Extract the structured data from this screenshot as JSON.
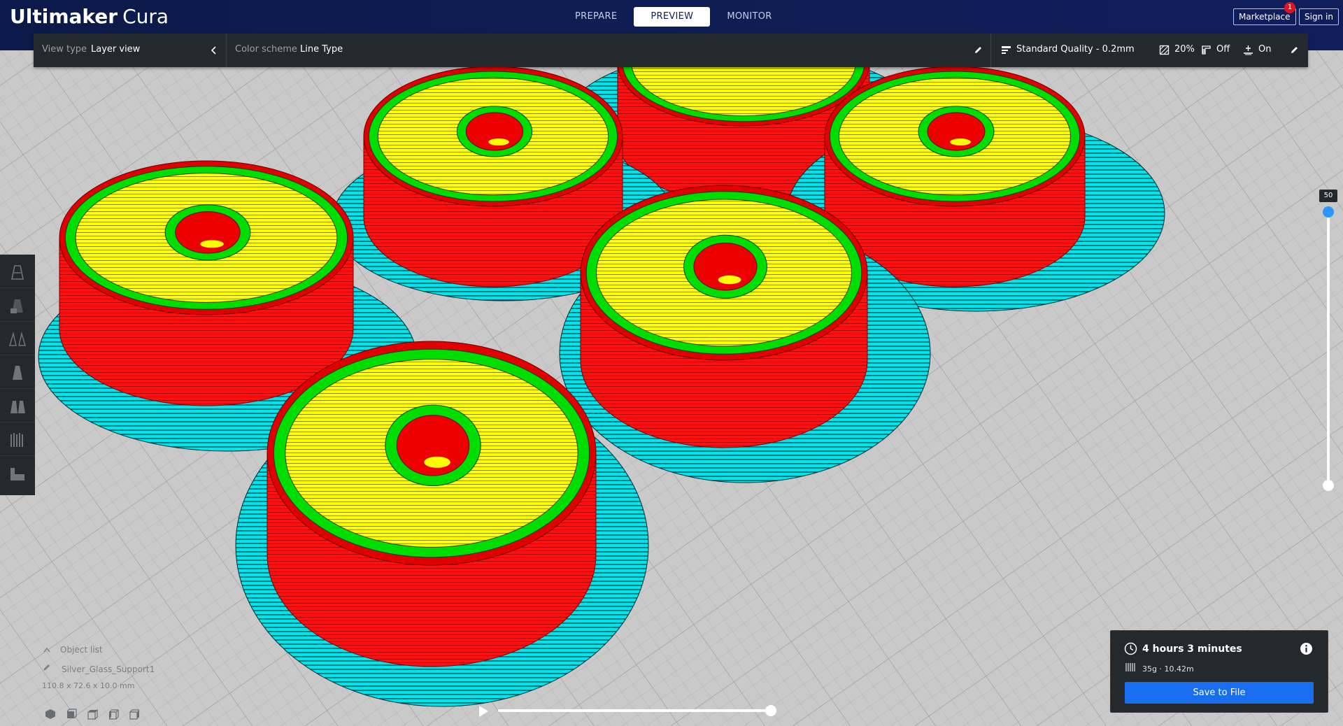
{
  "app": {
    "name_bold": "Ultimaker",
    "name_light": "Cura"
  },
  "stages": [
    {
      "label": "PREPARE",
      "active": false
    },
    {
      "label": "PREVIEW",
      "active": true
    },
    {
      "label": "MONITOR",
      "active": false
    }
  ],
  "header": {
    "marketplace_label": "Marketplace",
    "notification_count": "1",
    "sign_in_label": "Sign in"
  },
  "view_bar": {
    "view_type_label": "View type",
    "view_type_value": "Layer view",
    "color_scheme_label": "Color scheme",
    "color_scheme_value": "Line Type",
    "profile": "Standard Quality - 0.2mm",
    "infill": "20%",
    "support": "Off",
    "adhesion": "On"
  },
  "tools": [
    {
      "name": "per-model-settings-icon"
    },
    {
      "name": "support-blocker-icon"
    },
    {
      "name": "mirror-icon"
    },
    {
      "name": "scale-icon"
    },
    {
      "name": "rotate-icon"
    },
    {
      "name": "translate-icon"
    },
    {
      "name": "lay-flat-icon"
    }
  ],
  "layer_slider": {
    "value": "50",
    "top_fraction": 1.0,
    "bottom_fraction": 0.0
  },
  "object_list": {
    "title": "Object list",
    "object_name": "Silver_Glass_Support1",
    "dimensions": "110.8 x 72.6 x 10.0 mm"
  },
  "playback": {
    "progress": 1.0
  },
  "print_info": {
    "time": "4 hours 3 minutes",
    "material": "35g · 10.42m",
    "save_label": "Save to File"
  },
  "colors": {
    "header_bg": "#0e1d52",
    "panel_bg": "#24292e",
    "accent_blue": "#196ef0",
    "wall_outer": "#ff0000",
    "wall_inner": "#00e600",
    "skin_top": "#ffff00",
    "skirt_brim": "#00e6e6",
    "build_plate": "#c8c8c8"
  }
}
